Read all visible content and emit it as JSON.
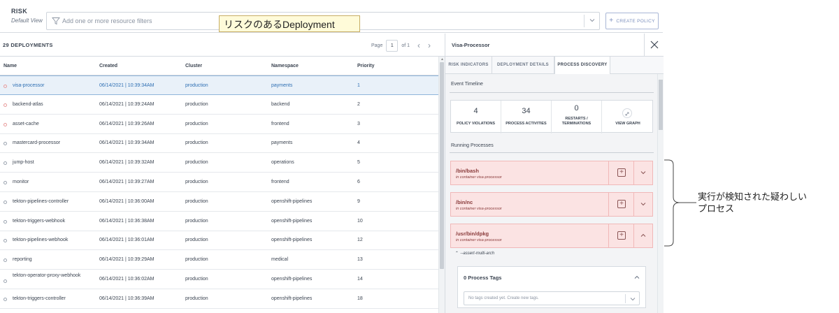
{
  "header": {
    "title": "RISK",
    "subtitle": "Default View",
    "filter_placeholder": "Add one or more resource filters",
    "create_policy_label": "CREATE POLICY"
  },
  "callouts": {
    "top": "リスクのあるDeployment",
    "right": "実行が検知された疑わしい\nプロセス"
  },
  "table": {
    "count_label": "29 DEPLOYMENTS",
    "pager": {
      "page_label": "Page",
      "page": "1",
      "of_label": "of 1"
    },
    "columns": [
      "Name",
      "Created",
      "Cluster",
      "Namespace",
      "Priority"
    ],
    "rows": [
      {
        "name": "visa-processor",
        "created": "06/14/2021 | 10:39:34AM",
        "cluster": "production",
        "namespace": "payments",
        "priority": "1",
        "selected": true,
        "warn": true
      },
      {
        "name": "backend-atlas",
        "created": "06/14/2021 | 10:39:24AM",
        "cluster": "production",
        "namespace": "backend",
        "priority": "2",
        "warn": true
      },
      {
        "name": "asset-cache",
        "created": "06/14/2021 | 10:39:26AM",
        "cluster": "production",
        "namespace": "frontend",
        "priority": "3",
        "warn": true
      },
      {
        "name": "mastercard-processor",
        "created": "06/14/2021 | 10:39:34AM",
        "cluster": "production",
        "namespace": "payments",
        "priority": "4"
      },
      {
        "name": "jump-host",
        "created": "06/14/2021 | 10:39:32AM",
        "cluster": "production",
        "namespace": "operations",
        "priority": "5"
      },
      {
        "name": "monitor",
        "created": "06/14/2021 | 10:39:27AM",
        "cluster": "production",
        "namespace": "frontend",
        "priority": "6"
      },
      {
        "name": "tekton-pipelines-controller",
        "created": "06/14/2021 | 10:36:00AM",
        "cluster": "production",
        "namespace": "openshift-pipelines",
        "priority": "9"
      },
      {
        "name": "tekton-triggers-webhook",
        "created": "06/14/2021 | 10:36:38AM",
        "cluster": "production",
        "namespace": "openshift-pipelines",
        "priority": "10"
      },
      {
        "name": "tekton-pipelines-webhook",
        "created": "06/14/2021 | 10:36:01AM",
        "cluster": "production",
        "namespace": "openshift-pipelines",
        "priority": "12"
      },
      {
        "name": "reporting",
        "created": "06/14/2021 | 10:39:29AM",
        "cluster": "production",
        "namespace": "medical",
        "priority": "13"
      },
      {
        "name": "tekton-operator-proxy-webhook",
        "created": "06/14/2021 | 10:36:02AM",
        "cluster": "production",
        "namespace": "openshift-pipelines",
        "priority": "14",
        "two_line": true
      },
      {
        "name": "tekton-triggers-controller",
        "created": "06/14/2021 | 10:36:39AM",
        "cluster": "production",
        "namespace": "openshift-pipelines",
        "priority": "18"
      }
    ]
  },
  "side": {
    "title": "Visa-Processor",
    "tabs": [
      "RISK INDICATORS",
      "DEPLOYMENT DETAILS",
      "PROCESS DISCOVERY"
    ],
    "active_tab": 2,
    "event_timeline_label": "Event Timeline",
    "stats": [
      {
        "value": "4",
        "label": "POLICY VIOLATIONS"
      },
      {
        "value": "34",
        "label": "PROCESS ACTIVITIES"
      },
      {
        "value": "0",
        "label": "RESTARTS / TERMINATIONS"
      },
      {
        "value": "",
        "label": "VIEW GRAPH"
      }
    ],
    "running_processes_label": "Running Processes",
    "processes": [
      {
        "name": "/bin/bash",
        "container": "in container visa-processor",
        "expanded": false
      },
      {
        "name": "/bin/nc",
        "container": "in container visa-processor",
        "expanded": false
      },
      {
        "name": "/usr/bin/dpkg",
        "container": "in container visa-processor",
        "expanded": true
      }
    ],
    "arg_line": "--assert-multi-arch",
    "tags_title": "0 Process Tags",
    "tags_placeholder": "No tags created yet. Create new tags."
  },
  "colors": {
    "selected_row": "#e9f1f9",
    "process_bg": "#fbe3e3",
    "callout_bg": "#fffbd9"
  }
}
